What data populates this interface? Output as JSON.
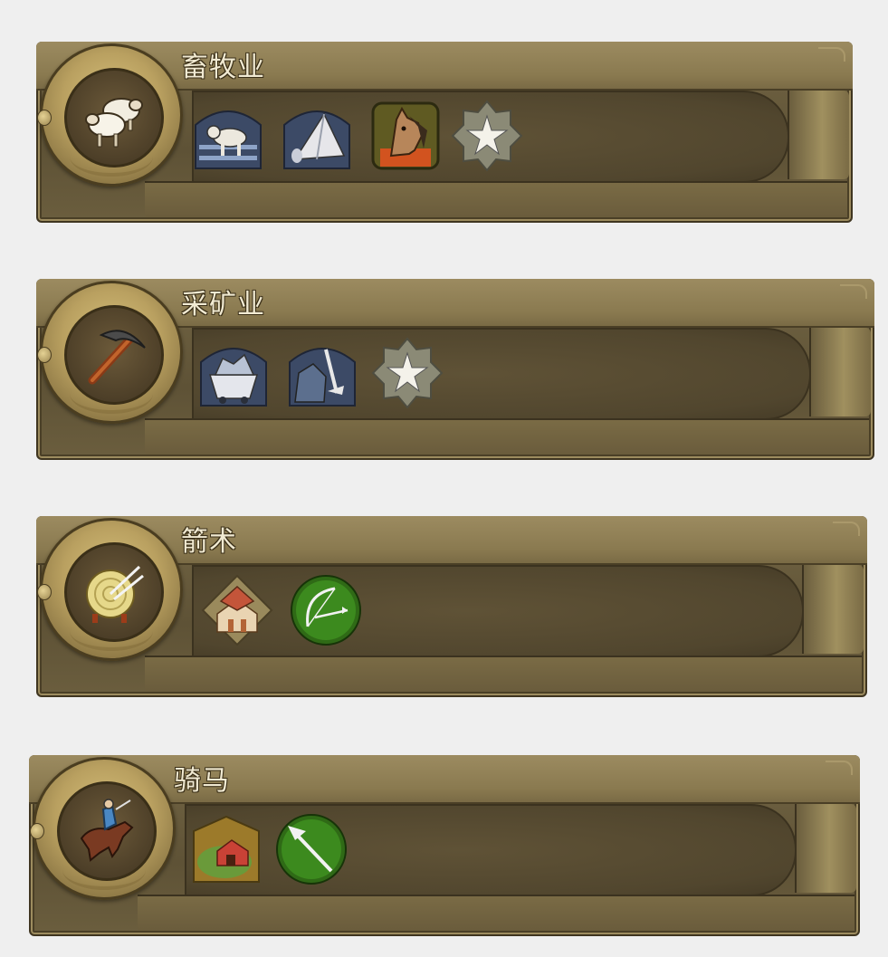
{
  "cards": [
    {
      "title": "畜牧业",
      "tech_icon": "sheep-icon",
      "unlocks": [
        {
          "icon": "cattle-pasture-icon",
          "kind": "improvement"
        },
        {
          "icon": "tent-camp-icon",
          "kind": "improvement"
        },
        {
          "icon": "horse-resource-icon",
          "kind": "resource"
        },
        {
          "icon": "star-bonus-icon",
          "kind": "bonus"
        }
      ]
    },
    {
      "title": "采矿业",
      "tech_icon": "pickaxe-icon",
      "unlocks": [
        {
          "icon": "mine-cart-icon",
          "kind": "improvement"
        },
        {
          "icon": "quarry-icon",
          "kind": "improvement"
        },
        {
          "icon": "star-bonus-icon",
          "kind": "bonus"
        }
      ]
    },
    {
      "title": "箭术",
      "tech_icon": "archery-target-icon",
      "unlocks": [
        {
          "icon": "archery-range-building-icon",
          "kind": "building"
        },
        {
          "icon": "bow-unit-icon",
          "kind": "unit"
        }
      ]
    },
    {
      "title": "骑马",
      "tech_icon": "horseman-icon",
      "unlocks": [
        {
          "icon": "stable-building-icon",
          "kind": "building"
        },
        {
          "icon": "spear-unit-icon",
          "kind": "unit"
        }
      ]
    }
  ],
  "colors": {
    "page_bg": "#efefef",
    "panel_gold": "#8a7a52",
    "panel_dark": "#51462e",
    "title_text": "#f1ead2",
    "unit_green": "#2f6a16",
    "improvement_blue": "#3c4a66"
  }
}
